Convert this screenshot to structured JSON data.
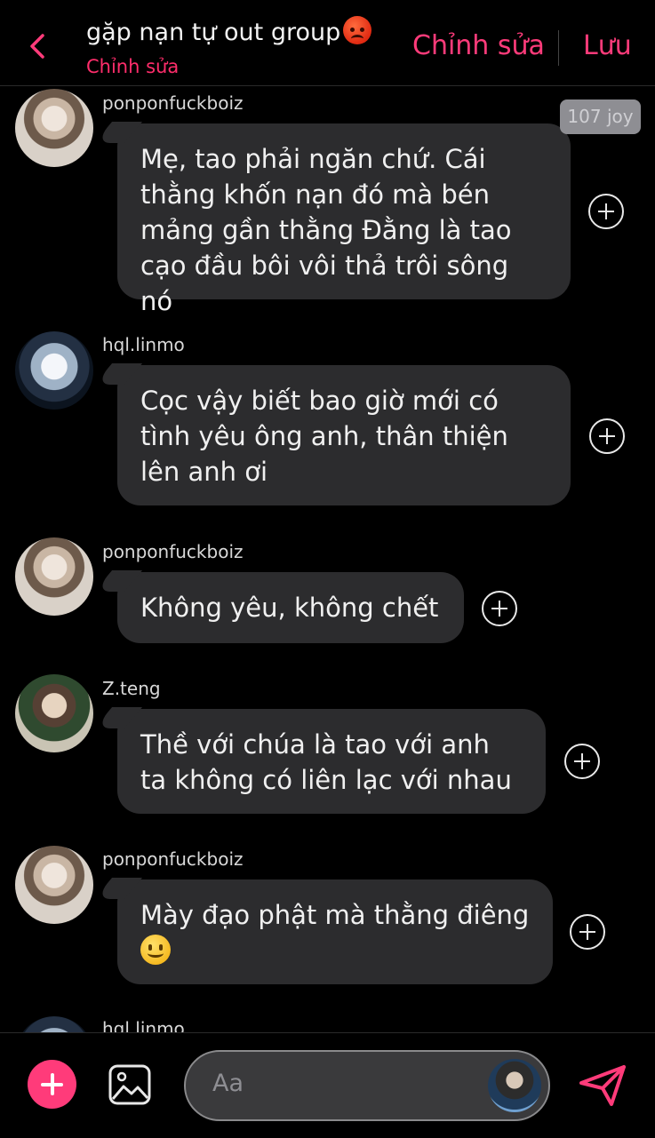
{
  "header": {
    "title": "gặp nạn tự out group",
    "subtitle": "Chỉnh sửa",
    "edit_label": "Chỉnh sửa",
    "save_label": "Lưu",
    "title_emoji": "angry-face-emoji"
  },
  "reaction_badge": "107 joy",
  "messages": [
    {
      "username": "ponponfuckboiz",
      "text": "Mẹ, tao phải ngăn chứ. Cái thằng khốn nạn đó mà bén mảng gần thằng Đằng là tao cạo đầu bôi vôi thả trôi sông nó"
    },
    {
      "username": "hql.linmo",
      "text": "Cọc vậy biết bao giờ mới có tình yêu ông anh, thân thiện lên anh ơi"
    },
    {
      "username": "ponponfuckboiz",
      "text": "Không yêu, không chết"
    },
    {
      "username": "Z.teng",
      "text": "Thề với chúa là tao với anh ta không có liên lạc với nhau"
    },
    {
      "username": "ponponfuckboiz",
      "text": "Mày đạo phật mà thằng điêng",
      "emoji": "slightly-smiling-face-emoji"
    },
    {
      "username": "hql.linmo",
      "text": ""
    }
  ],
  "composer": {
    "placeholder": "Aa"
  },
  "colors": {
    "accent": "#ff3b7a",
    "bubble": "#2c2c2e",
    "background": "#000000"
  },
  "icons": {
    "back": "chevron-left-icon",
    "add": "plus-icon",
    "image": "image-icon",
    "send": "send-icon",
    "react": "add-reaction-icon"
  }
}
